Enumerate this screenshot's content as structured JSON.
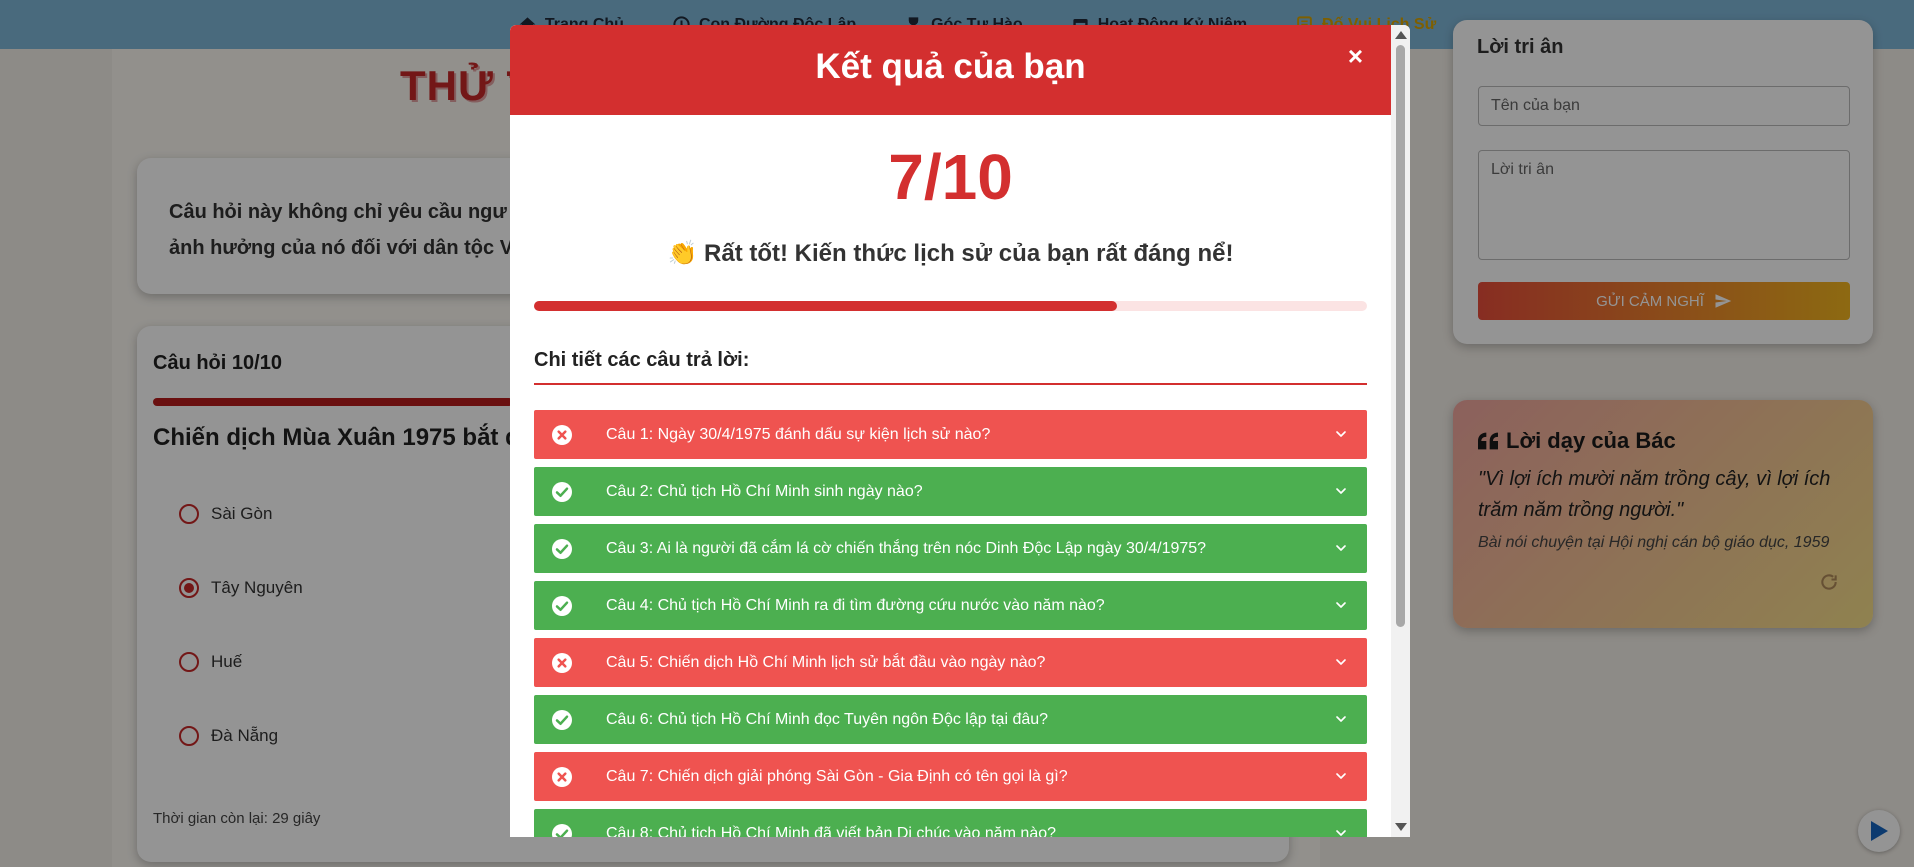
{
  "nav": {
    "items": [
      {
        "label": "Trang Chủ",
        "icon": "home-icon"
      },
      {
        "label": "Con Đường Độc Lập",
        "icon": "history-icon"
      },
      {
        "label": "Góc Tự Hào",
        "icon": "trophy-icon"
      },
      {
        "label": "Hoạt Động Kỷ Niệm",
        "icon": "calendar-icon"
      },
      {
        "label": "Đố Vui Lịch Sử",
        "icon": "book-icon",
        "active": true
      }
    ]
  },
  "page": {
    "title": "THỬ T",
    "intro_text": "Câu hỏi này không chỉ yêu cầu ngư ảnh hưởng của nó đối với dân tộc V"
  },
  "quiz": {
    "counter": "Câu hỏi 10/10",
    "question": "Chiến dịch Mùa Xuân 1975 bắt đ",
    "options": [
      "Sài Gòn",
      "Tây Nguyên",
      "Huế",
      "Đà Nẵng"
    ],
    "selected_index": 1,
    "timer": "Thời gian còn lại: 29 giây"
  },
  "sidebar": {
    "gratitude_title": "Lời tri ân",
    "name_placeholder": "Tên của bạn",
    "message_placeholder": "Lời tri ân",
    "send_label": "GỬI CẢM NGHĨ",
    "quote_title": "Lời dạy của Bác",
    "quote_text": "\"Vì lợi ích mười năm trồng cây, vì lợi ích trăm năm trồng người.\"",
    "quote_source": "Bài nói chuyện tại Hội nghị cán bộ giáo dục, 1959"
  },
  "modal": {
    "title": "Kết quả của bạn",
    "close_symbol": "×",
    "score": "7/10",
    "score_fraction": 0.7,
    "message": "👏 Rất tốt! Kiến thức lịch sử của bạn rất đáng nể!",
    "details_title": "Chi tiết các câu trả lời:",
    "answers": [
      {
        "text": "Câu 1: Ngày 30/4/1975 đánh dấu sự kiện lịch sử nào?",
        "correct": false
      },
      {
        "text": "Câu 2: Chủ tịch Hồ Chí Minh sinh ngày nào?",
        "correct": true
      },
      {
        "text": "Câu 3: Ai là người đã cắm lá cờ chiến thắng trên nóc Dinh Độc Lập ngày 30/4/1975?",
        "correct": true
      },
      {
        "text": "Câu 4: Chủ tịch Hồ Chí Minh ra đi tìm đường cứu nước vào năm nào?",
        "correct": true
      },
      {
        "text": "Câu 5: Chiến dịch Hồ Chí Minh lịch sử bắt đầu vào ngày nào?",
        "correct": false
      },
      {
        "text": "Câu 6: Chủ tịch Hồ Chí Minh đọc Tuyên ngôn Độc lập tại đâu?",
        "correct": true
      },
      {
        "text": "Câu 7: Chiến dịch giải phóng Sài Gòn - Gia Định có tên gọi là gì?",
        "correct": false
      },
      {
        "text": "Câu 8: Chủ tịch Hồ Chí Minh đã viết bản Di chúc vào năm nào?",
        "correct": true
      }
    ]
  },
  "colors": {
    "primary_red": "#d32f2f",
    "wrong": "#ef5350",
    "right": "#4caf50",
    "nav_bg": "#7fb7d8",
    "nav_active": "#d9a400"
  }
}
